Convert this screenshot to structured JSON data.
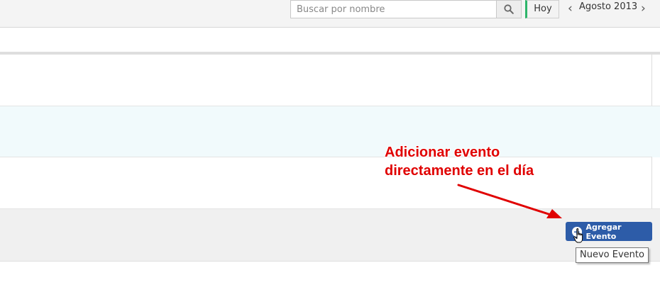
{
  "toolbar": {
    "search_placeholder": "Buscar por nombre",
    "search_value": "",
    "search_icon": "magnifier-icon",
    "today_label": "Hoy",
    "prev_arrow": "‹",
    "month_label": "Agosto 2013",
    "next_arrow": "›"
  },
  "annotation": {
    "line1": "Adicionar evento",
    "line2": "directamente en el día",
    "color": "#e00000"
  },
  "day_cell": {
    "add_button_icon": "plus-circle-icon",
    "add_button_label": "Agregar Evento",
    "add_button_color": "#2d5ca8",
    "tooltip": "Nuevo Evento",
    "cursor_icon": "hand-pointer-icon"
  },
  "colors": {
    "today_accent": "#2db56a",
    "highlight_row": "#f1fafc"
  }
}
